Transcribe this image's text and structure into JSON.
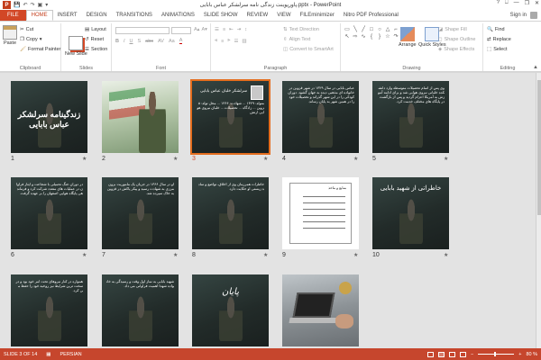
{
  "window": {
    "title": "پاورپوینت زندگی نامه سرلشکر عباس بابایی.pptx - PowerPoint",
    "controls": [
      "?",
      "⎕",
      "—",
      "❐",
      "✕"
    ]
  },
  "qat": {
    "app_icon": "P",
    "save": "💾",
    "undo": "↶",
    "redo": "↷",
    "start": "▣",
    "more": "▾"
  },
  "tabs": [
    "FILE",
    "HOME",
    "INSERT",
    "DESIGN",
    "TRANSITIONS",
    "ANIMATIONS",
    "SLIDE SHOW",
    "REVIEW",
    "VIEW",
    "FILEminimizer",
    "Nitro PDF Professional"
  ],
  "active_tab": "HOME",
  "signin": "Sign in",
  "ribbon": {
    "clipboard": {
      "paste": "Paste",
      "cut": "Cut",
      "copy": "Copy",
      "format_painter": "Format Painter",
      "label": "Clipboard"
    },
    "slides": {
      "new_slide": "New Slide",
      "layout": "Layout",
      "reset": "Reset",
      "section": "Section",
      "label": "Slides"
    },
    "font": {
      "label": "Font",
      "bold": "B",
      "italic": "I",
      "underline": "U",
      "shadow": "S",
      "strike": "abc",
      "spacing": "AV",
      "case": "Aa",
      "color": "A"
    },
    "paragraph": {
      "text_direction": "Text Direction",
      "align_text": "Align Text",
      "convert": "Convert to SmartArt",
      "label": "Paragraph"
    },
    "drawing": {
      "arrange": "Arrange",
      "quick_styles": "Quick Styles",
      "shape_fill": "Shape Fill",
      "shape_outline": "Shape Outline",
      "shape_effects": "Shape Effects",
      "label": "Drawing"
    },
    "editing": {
      "find": "Find",
      "replace": "Replace",
      "select": "Select",
      "label": "Editing"
    }
  },
  "slides": [
    {
      "n": "1",
      "title": "زندگینامه سرلشکر عباس بابایی"
    },
    {
      "n": "2"
    },
    {
      "n": "3",
      "heading": "سرلشکر خلبان عباس بابایی",
      "body": "متولد: ۱۳۲۹ ... شهادت: ۱۳۶۶ ... محل تولد: قزوین ... زادگاه ... تحصیلات ... خلبان نیروی هوایی ارتش"
    },
    {
      "n": "4",
      "body": "عباس بابایی در سال ۱۳۲۹ در شهر قزوین در خانواده ای مذهبی دیده به جهان گشود. دوران کودکی را در این شهر گذراند و تحصیلات خود را در همین شهر به پایان رساند."
    },
    {
      "n": "5",
      "body": "وی پس از اتمام تحصیلات متوسطه وارد دانشکده خلبانی نیروی هوایی شد و برای ادامه آموزش به آمریکا اعزام گردید و پس از بازگشت در پایگاه های مختلف خدمت کرد."
    },
    {
      "n": "6",
      "body": "در دوران جنگ تحمیلی با شجاعت و ایثار فراوان در عملیات های متعدد شرکت کرد و فرماندهی پایگاه هوایی اصفهان را بر عهده گرفت."
    },
    {
      "n": "7",
      "body": "او در سال ۱۳۶۶ در جریان یک ماموریت برون مرزی به شهادت رسید و پیکر پاکش در قزوین به خاک سپرده شد."
    },
    {
      "n": "8",
      "body": "خاطرات همرزمان وی از اخلاق، تواضع و ساده زیستی او حکایت دارد."
    },
    {
      "n": "9",
      "body": "منابع و ماخذ"
    },
    {
      "n": "10",
      "heading": "خاطراتی از شهید بابایی"
    },
    {
      "n": "11",
      "body": "همواره در کنار نیروهای تحت امر خود بود و در سخت ترین شرایط نیز روحیه خود را حفظ می کرد."
    },
    {
      "n": "12",
      "body": "شهید بابایی به نماز اول وقت و رسیدگی به خانواده شهدا اهمیت فراوانی می داد."
    },
    {
      "n": "13",
      "heading": "پایان"
    },
    {
      "n": "14"
    }
  ],
  "selected_slide": "3",
  "status": {
    "slide_info": "SLIDE 3 OF 14",
    "language": "PERSIAN",
    "zoom": "80 %",
    "zoom_minus": "−",
    "zoom_plus": "+",
    "transition_star": "★"
  }
}
